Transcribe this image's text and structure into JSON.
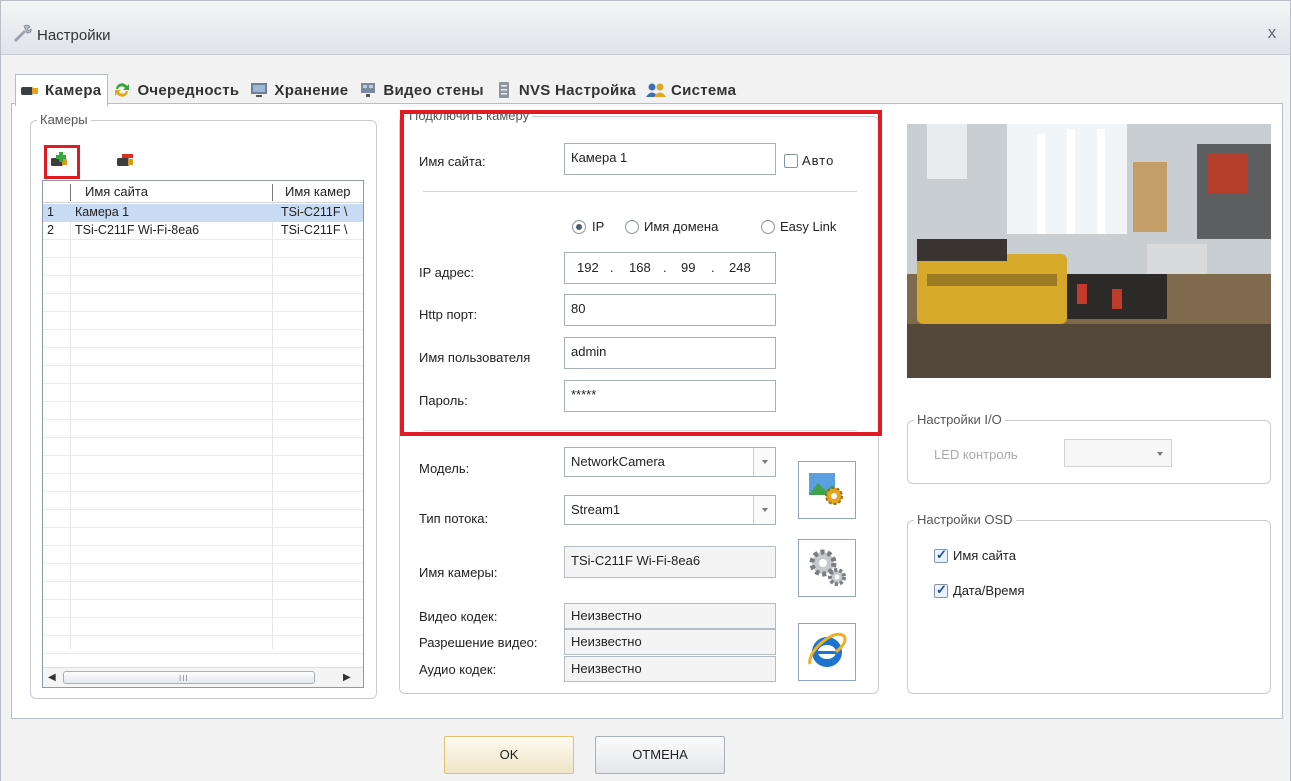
{
  "window": {
    "title": "Настройки",
    "close_label": "x"
  },
  "tabs": [
    {
      "label": "Камера",
      "icon": "camera-icon"
    },
    {
      "label": "Очередность",
      "icon": "cycle-arrows-icon"
    },
    {
      "label": "Хранение",
      "icon": "monitor-icon"
    },
    {
      "label": "Видео стены",
      "icon": "video-wall-icon"
    },
    {
      "label": "NVS Настройка",
      "icon": "server-icon"
    },
    {
      "label": "Система",
      "icon": "users-icon"
    }
  ],
  "cameras": {
    "legend": "Камеры",
    "columns": [
      "Имя сайта",
      "Имя камер"
    ],
    "rows": [
      {
        "num": "1",
        "site": "Камера 1",
        "camera": "TSi-C211F \\"
      },
      {
        "num": "2",
        "site": "TSi-C211F Wi-Fi-8ea6",
        "camera": "TSi-C211F \\"
      }
    ],
    "scroll_grip": "III"
  },
  "connect": {
    "legend": "Подключить камеру",
    "site_label": "Имя сайта:",
    "site_value": "Камера 1",
    "auto_label": "Авто",
    "radio_ip": "IP",
    "radio_domain": "Имя домена",
    "radio_easylink": "Easy Link",
    "ip_label": "IP адрес:",
    "ip": [
      "192",
      "168",
      "99",
      "248"
    ],
    "ip_dot": ".",
    "http_label": "Http порт:",
    "http_value": "80",
    "user_label": "Имя пользователя",
    "user_value": "admin",
    "pass_label": "Пароль:",
    "pass_value": "*****",
    "model_label": "Модель:",
    "model_value": "NetworkCamera",
    "stream_label": "Тип потока:",
    "stream_value": "Stream1",
    "cam_name_label": "Имя камеры:",
    "cam_name_value": "TSi-C211F Wi-Fi-8ea6",
    "video_codec_label": "Видео кодек:",
    "video_codec_value": "Неизвестно",
    "resolution_label": "Разрешение видео:",
    "resolution_value": "Неизвестно",
    "audio_codec_label": "Аудио кодек:",
    "audio_codec_value": "Неизвестно"
  },
  "io": {
    "legend": "Настройки I/O",
    "led_label": "LED контроль"
  },
  "osd": {
    "legend": "Настройки OSD",
    "site_name_label": "Имя сайта",
    "datetime_label": "Дата/Время"
  },
  "buttons": {
    "ok": "OK",
    "cancel": "ОТМЕНА"
  },
  "colors": {
    "highlight": "#e01b24",
    "selection": "#c9daf3"
  }
}
